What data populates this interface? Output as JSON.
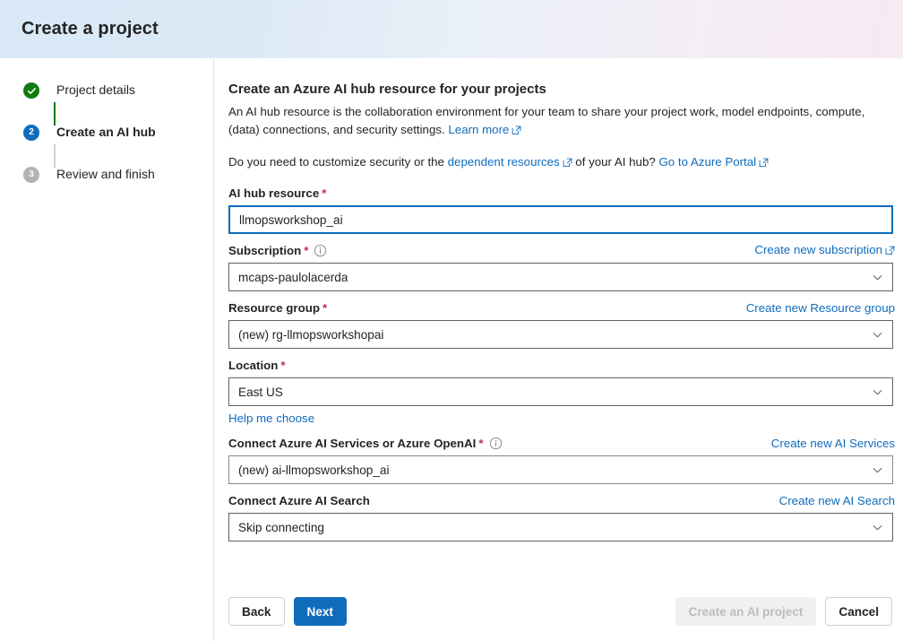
{
  "header": {
    "title": "Create a project"
  },
  "sidebar": {
    "steps": [
      {
        "label": "Project details",
        "state": "done",
        "marker": "check"
      },
      {
        "label": "Create an AI hub",
        "state": "active",
        "marker": "2"
      },
      {
        "label": "Review and finish",
        "state": "todo",
        "marker": "3"
      }
    ]
  },
  "main": {
    "heading": "Create an Azure AI hub resource for your projects",
    "description_part1": "An AI hub resource is the collaboration environment for your team to share your project work, model endpoints, compute, (data) connections, and security settings.",
    "learn_more_label": "Learn more",
    "customize_prefix": "Do you need to customize security or the",
    "dependent_resources_label": "dependent resources",
    "customize_middle": "of your AI hub?",
    "azure_portal_label": "Go to Azure Portal",
    "fields": {
      "ai_hub_resource": {
        "label": "AI hub resource",
        "required": "*",
        "value": "llmopsworkshop_ai"
      },
      "subscription": {
        "label": "Subscription",
        "required": "*",
        "info": "i",
        "action_label": "Create new subscription",
        "value": "mcaps-paulolacerda"
      },
      "resource_group": {
        "label": "Resource group",
        "required": "*",
        "action_label": "Create new Resource group",
        "value": "(new) rg-llmopsworkshopai"
      },
      "location": {
        "label": "Location",
        "required": "*",
        "value": "East US",
        "helper_label": "Help me choose"
      },
      "ai_services": {
        "label": "Connect Azure AI Services or Azure OpenAI",
        "required": "*",
        "info": "i",
        "action_label": "Create new AI Services",
        "value": "(new) ai-llmopsworkshop_ai"
      },
      "ai_search": {
        "label": "Connect Azure AI Search",
        "action_label": "Create new AI Search",
        "value": "Skip connecting"
      }
    }
  },
  "footer": {
    "back_label": "Back",
    "next_label": "Next",
    "create_project_label": "Create an AI project",
    "cancel_label": "Cancel"
  },
  "colors": {
    "accent_blue": "#0f6cbd",
    "success_green": "#107c10",
    "required_red": "#c4314b",
    "step_todo_grey": "#b3b3b3"
  }
}
